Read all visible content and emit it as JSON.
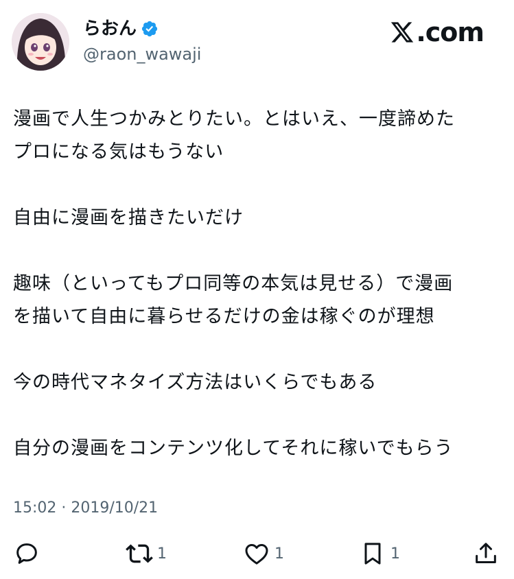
{
  "author": {
    "display_name": "らおん",
    "handle": "@raon_wawaji",
    "verified": true
  },
  "brand": {
    "label": ".com"
  },
  "tweet": {
    "paragraphs": [
      [
        "漫画で人生つかみとりたい。とはいえ、一度諦めた",
        "プロになる気はもうない"
      ],
      [
        "自由に漫画を描きたいだけ"
      ],
      [
        "趣味（といってもプロ同等の本気は見せる）で漫画",
        "を描いて自由に暮らせるだけの金は稼ぐのが理想"
      ],
      [
        "今の時代マネタイズ方法はいくらでもある"
      ],
      [
        "自分の漫画をコンテンツ化してそれに稼いでもらう"
      ]
    ],
    "timestamp": "15:02 · 2019/10/21"
  },
  "actions": {
    "reply_icon": "reply-icon",
    "retweet_count": "1",
    "like_count": "1",
    "bookmark_count": "1",
    "share_icon": "share-icon"
  },
  "colors": {
    "text": "#0f1419",
    "secondary": "#536471",
    "verified": "#1d9bf0"
  }
}
